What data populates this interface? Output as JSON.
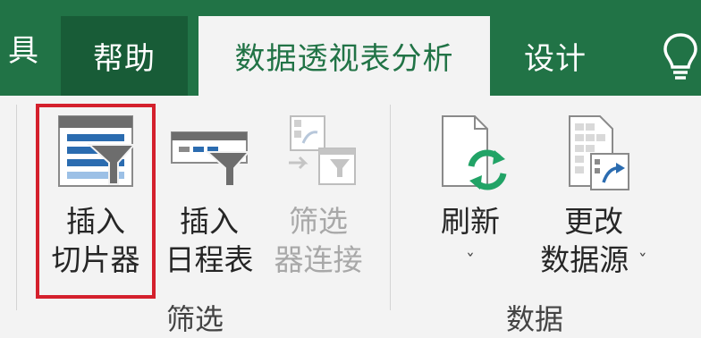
{
  "tabs": {
    "clipped": "具",
    "help": "帮助",
    "active": "数据透视表分析",
    "design": "设计"
  },
  "commands": {
    "insert_slicer": {
      "line1": "插入",
      "line2": "切片器"
    },
    "insert_timeline": {
      "line1": "插入",
      "line2": "日程表"
    },
    "filter_connections": {
      "line1": "筛选",
      "line2": "器连接"
    },
    "refresh": {
      "line1": "刷新",
      "chevron": "ˇ"
    },
    "change_source": {
      "line1": "更改",
      "line2": "数据源",
      "chevron": "ˇ"
    }
  },
  "groups": {
    "filter": "筛选",
    "data": "数据"
  },
  "colors": {
    "brand_green": "#217346",
    "dark_green": "#185c37",
    "highlight_red": "#d4202c"
  },
  "icons": [
    "slicer-icon",
    "timeline-icon",
    "filter-connections-icon",
    "refresh-icon",
    "change-data-source-icon",
    "lightbulb-icon"
  ]
}
